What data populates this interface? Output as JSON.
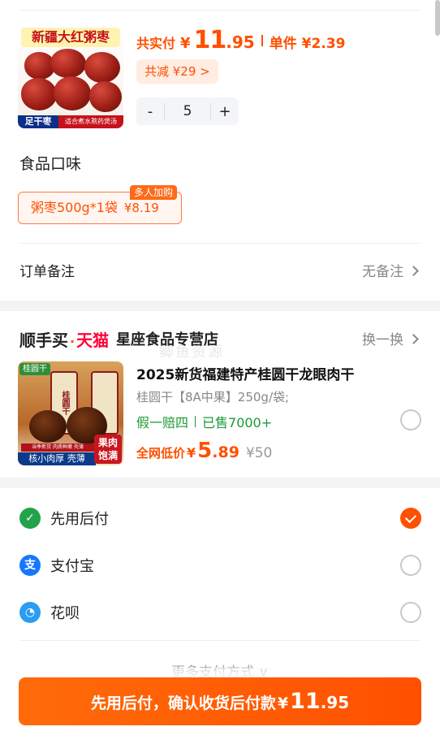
{
  "order_item": {
    "image_title": "新疆大红粥枣",
    "image_footer_left": "足干枣",
    "image_footer_right": "适合煮水熬药煲汤",
    "price_label": "共实付",
    "currency": "¥",
    "price_int": "11",
    "price_dec": ".95",
    "unit_price": "单件 ¥2.39",
    "discount": "共减 ¥29 >",
    "quantity": "5",
    "minus": "-",
    "plus": "+"
  },
  "flavor": {
    "title": "食品口味",
    "option_label": "粥枣500g*1袋",
    "option_price": "¥8.19",
    "badge": "多人加购"
  },
  "remark": {
    "label": "订单备注",
    "value": "无备注"
  },
  "recommend": {
    "brand": "顺手买",
    "dot": "·",
    "tmall": "天猫",
    "store": "星座食品专营店",
    "action": "换一换",
    "watermark": "鲫鱼资源",
    "image_tag": "桂圆干",
    "image_jar_text": "桂圆干",
    "image_sub": "当季新货 肉质鲜嫩 壳薄",
    "image_footer": "核小肉厚 壳薄",
    "image_badge": "果肉饱满",
    "title": "2025新货福建特产桂圆干龙眼肉干",
    "spec": "桂圆干【8A中果】250g/袋;",
    "tag1": "假一赔四",
    "tag2": "已售7000+",
    "price_label": "全网低价",
    "currency": "¥",
    "price_int": "5",
    "price_dec": ".89",
    "orig_price": "¥50"
  },
  "payment": {
    "options": [
      {
        "label": "先用后付",
        "icon": "pay-later-icon",
        "color": "#22a34a",
        "selected": true
      },
      {
        "label": "支付宝",
        "icon": "alipay-icon",
        "color": "#1677ff",
        "selected": false
      },
      {
        "label": "花呗",
        "icon": "huabei-icon",
        "color": "#2b9cf2",
        "selected": false
      }
    ],
    "more": "更多支付方式 ∨"
  },
  "confirm": {
    "text": "先用后付，确认收货后付款",
    "currency": "¥",
    "price_int": "11",
    "price_dec": ".95"
  },
  "colors": {
    "accent": "#ff5000",
    "green": "#1a9a36"
  }
}
